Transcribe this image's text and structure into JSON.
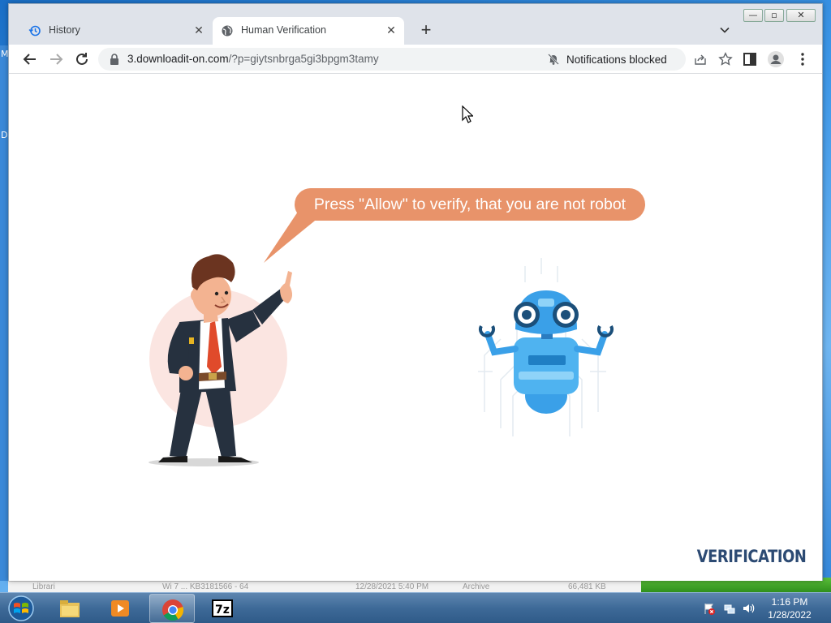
{
  "browser": {
    "tabs": [
      {
        "label": "History",
        "icon": "history-icon",
        "active": false
      },
      {
        "label": "Human Verification",
        "icon": "globe-icon",
        "active": true
      }
    ],
    "new_tab_symbol": "+",
    "window_controls": {
      "minimize": "—",
      "maximize": "▫",
      "close": "✕"
    },
    "address": {
      "host": "3.downloadit-on.com",
      "path": "/?p=giytsnbrga5gi3bpgm3tamy"
    },
    "notifications_label": "Notifications blocked"
  },
  "page": {
    "bubble_text": "Press \"Allow\" to verify, that you are not robot",
    "brand": "VERIFICATION"
  },
  "taskbar": {
    "apps": [
      "file-explorer",
      "media-player",
      "chrome",
      "7zip"
    ],
    "time": "1:16 PM",
    "date": "1/28/2022"
  },
  "desktop": {
    "left_letters": [
      "M",
      "D"
    ]
  },
  "background_window": {
    "row_name": "Librari",
    "file_name": "Wi 7 ... KB3181566 - 64",
    "date": "12/28/2021 5:40 PM",
    "type": "Archive",
    "size": "66,481 KB"
  },
  "colors": {
    "bubble": "#e8936a",
    "brand": "#2c4a73",
    "robot": "#3aa0e8"
  }
}
